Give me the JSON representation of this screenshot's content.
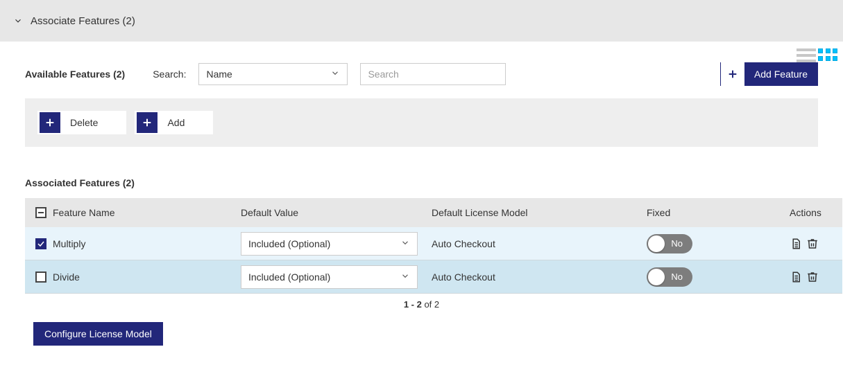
{
  "header": {
    "title": "Associate Features (2)"
  },
  "view_toggle": {
    "list_icon": "list-icon",
    "grid_icon": "grid-icon"
  },
  "available": {
    "label": "Available Features (2)",
    "search_label": "Search:",
    "search_by_value": "Name",
    "search_placeholder": "Search"
  },
  "add_feature": {
    "label": "Add Feature"
  },
  "strip": {
    "delete_label": "Delete",
    "add_label": "Add"
  },
  "associated": {
    "label": "Associated Features (2)",
    "columns": {
      "name": "Feature Name",
      "default_value": "Default Value",
      "license_model": "Default License Model",
      "fixed": "Fixed",
      "actions": "Actions"
    },
    "rows": [
      {
        "checked": true,
        "name": "Multiply",
        "default_value": "Included (Optional)",
        "license_model": "Auto Checkout",
        "fixed_label": "No"
      },
      {
        "checked": false,
        "name": "Divide",
        "default_value": "Included (Optional)",
        "license_model": "Auto Checkout",
        "fixed_label": "No"
      }
    ]
  },
  "pager": {
    "range": "1 - 2",
    "of": " of ",
    "total": "2"
  },
  "configure_btn": "Configure License Model"
}
